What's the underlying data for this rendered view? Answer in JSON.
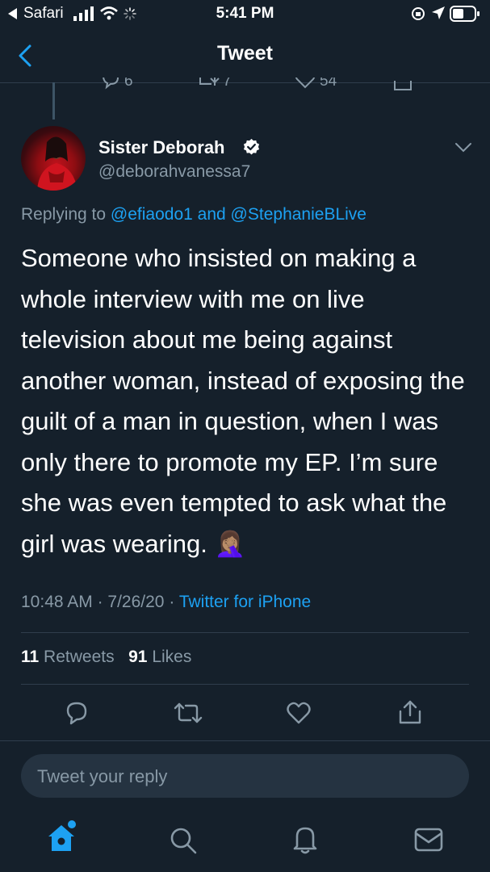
{
  "status_bar": {
    "back_app": "Safari",
    "time": "5:41 PM"
  },
  "nav": {
    "title": "Tweet"
  },
  "tweet": {
    "author_name": "Sister Deborah",
    "author_handle": "@deborahvanessa7",
    "replying_to_prefix": "Replying to",
    "replying_to_user1": "@efiaodo1",
    "replying_to_and": "and",
    "replying_to_user2": "@StephanieBLive",
    "text": "Someone who insisted on making a whole interview with me on live television about me being against another woman, instead of exposing the guilt of a man in question, when I was only there to promote my EP. I’m sure she was even tempted to ask what the girl was wearing. 🤦🏽‍♀️",
    "time": "10:48 AM",
    "date": "7/26/20",
    "source": "Twitter for iPhone",
    "retweets_count": "11",
    "retweets_label": "Retweets",
    "likes_count": "91",
    "likes_label": "Likes"
  },
  "previous_tweet_actions": {
    "replies": "6",
    "retweets": "7",
    "likes": "54"
  },
  "reply_box": {
    "placeholder": "Tweet your reply"
  },
  "colors": {
    "background": "#15202b",
    "accent": "#1da1f2",
    "muted": "#8899a6"
  }
}
